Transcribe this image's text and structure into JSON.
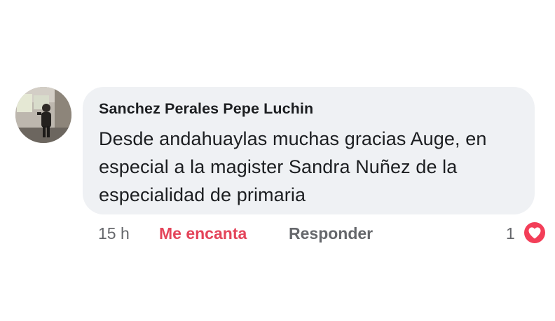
{
  "comment": {
    "author": "Sanchez Perales Pepe Luchin",
    "text": "Desde andahuaylas muchas gracias Auge, en especial a la magister Sandra Nuñez de la especialidad de primaria",
    "time": "15 h",
    "reaction_label": "Me encanta",
    "reply_label": "Responder",
    "reaction_count": "1",
    "reaction_icon": "heart-icon"
  },
  "colors": {
    "bubble_background": "#eff1f4",
    "reaction_color": "#e4445a",
    "meta_text": "#65676b",
    "heart_badge": "#f33e58"
  }
}
